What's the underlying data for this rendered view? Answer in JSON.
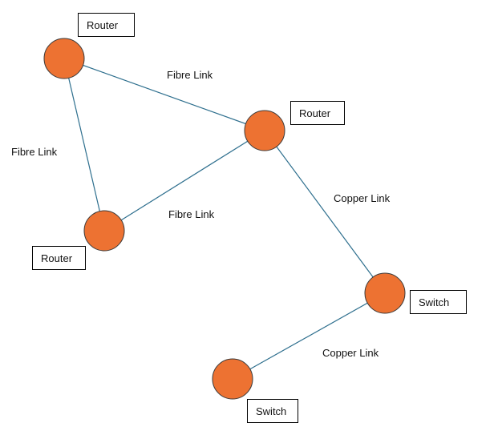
{
  "diagram": {
    "colors": {
      "node_fill": "#ED7232",
      "node_stroke": "#3a3a3a",
      "link": "#2E6F8E"
    },
    "nodes": [
      {
        "id": "n1",
        "label": "Router"
      },
      {
        "id": "n2",
        "label": "Router"
      },
      {
        "id": "n3",
        "label": "Router"
      },
      {
        "id": "n4",
        "label": "Switch"
      },
      {
        "id": "n5",
        "label": "Switch"
      }
    ],
    "links": [
      {
        "from": "n1",
        "to": "n2",
        "label": "Fibre Link"
      },
      {
        "from": "n1",
        "to": "n3",
        "label": "Fibre Link"
      },
      {
        "from": "n3",
        "to": "n2",
        "label": "Fibre Link"
      },
      {
        "from": "n2",
        "to": "n4",
        "label": "Copper Link"
      },
      {
        "from": "n4",
        "to": "n5",
        "label": "Copper Link"
      }
    ]
  }
}
